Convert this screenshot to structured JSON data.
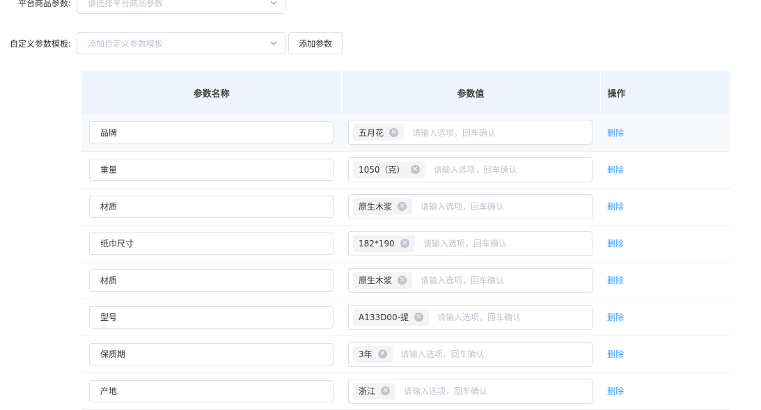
{
  "form": {
    "platform_label": "平台商品参数:",
    "platform_placeholder": "请选择平台商品参数",
    "custom_label": "自定义参数模板:",
    "custom_placeholder": "添加自定义参数模板",
    "add_button": "添加参数"
  },
  "table": {
    "headers": {
      "name": "参数名称",
      "value": "参数值",
      "op": "操作"
    },
    "tag_input_placeholder": "请输入选项，回车确认",
    "delete_label": "删除",
    "rows": [
      {
        "name": "品牌",
        "tag": "五月花"
      },
      {
        "name": "重量",
        "tag": "1050（克）"
      },
      {
        "name": "材质",
        "tag": "原生木浆"
      },
      {
        "name": "纸巾尺寸",
        "tag": "182*190"
      },
      {
        "name": "材质",
        "tag": "原生木浆"
      },
      {
        "name": "型号",
        "tag": "A133D00-提"
      },
      {
        "name": "保质期",
        "tag": "3年"
      },
      {
        "name": "产地",
        "tag": "浙江"
      }
    ]
  },
  "colors": {
    "accent": "#409eff",
    "header_bg": "#eef3fd",
    "tag_bg": "#f4f4f5"
  }
}
